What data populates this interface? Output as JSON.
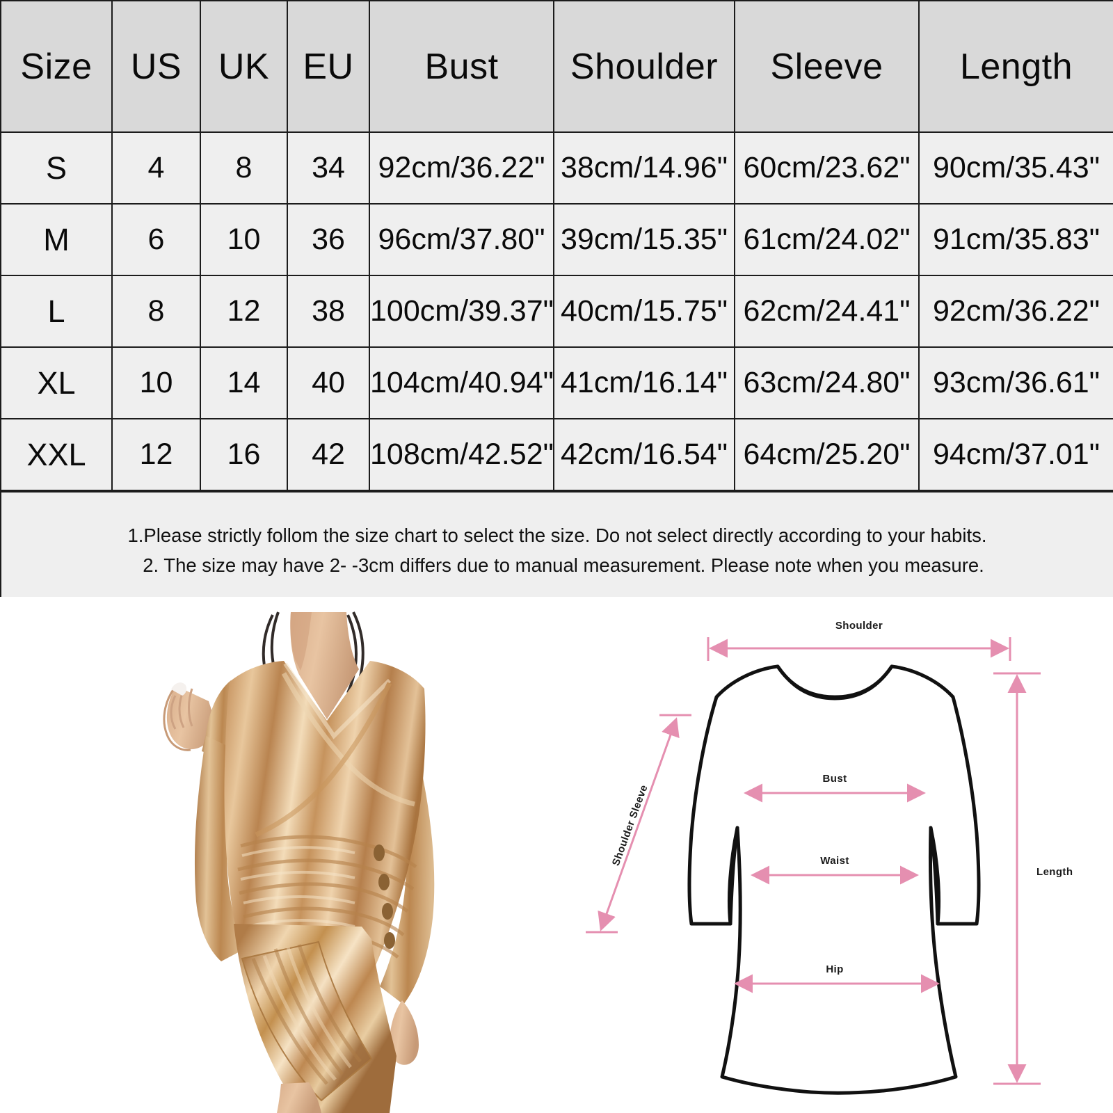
{
  "table": {
    "headers": [
      "Size",
      "US",
      "UK",
      "EU",
      "Bust",
      "Shoulder",
      "Sleeve",
      "Length"
    ],
    "rows": [
      {
        "size": "S",
        "us": "4",
        "uk": "8",
        "eu": "34",
        "bust": "92cm/36.22\"",
        "shoulder": "38cm/14.96\"",
        "sleeve": "60cm/23.62\"",
        "length": "90cm/35.43\""
      },
      {
        "size": "M",
        "us": "6",
        "uk": "10",
        "eu": "36",
        "bust": "96cm/37.80\"",
        "shoulder": "39cm/15.35\"",
        "sleeve": "61cm/24.02\"",
        "length": "91cm/35.83\""
      },
      {
        "size": "L",
        "us": "8",
        "uk": "12",
        "eu": "38",
        "bust": "100cm/39.37\"",
        "shoulder": "40cm/15.75\"",
        "sleeve": "62cm/24.41\"",
        "length": "92cm/36.22\""
      },
      {
        "size": "XL",
        "us": "10",
        "uk": "14",
        "eu": "40",
        "bust": "104cm/40.94\"",
        "shoulder": "41cm/16.14\"",
        "sleeve": "63cm/24.80\"",
        "length": "93cm/36.61\""
      },
      {
        "size": "XXL",
        "us": "12",
        "uk": "16",
        "eu": "42",
        "bust": "108cm/42.52\"",
        "shoulder": "42cm/16.54\"",
        "sleeve": "64cm/25.20\"",
        "length": "94cm/37.01\""
      }
    ],
    "notes": [
      "1.Please strictly follom the size chart to select the size. Do not select directly according to your habits.",
      "2. The size may have 2- -3cm differs due to manual measurement. Please note when you measure."
    ]
  },
  "diagram": {
    "labels": {
      "shoulder": "Shoulder",
      "shoulder_sleeve": "Shoulder Sleeve",
      "bust": "Bust",
      "waist": "Waist",
      "hip": "Hip",
      "length": "Length"
    },
    "colors": {
      "arrow": "#e58fb0",
      "outline": "#111111",
      "label": "#1a1a1a"
    }
  },
  "photo": {
    "alt": "woman-wearing-gold-metallic-ruched-bodycon-mini-dress",
    "colors": {
      "background": "#ffffff",
      "fabric_light": "#f0d3ae",
      "fabric_mid": "#d4a673",
      "fabric_dark": "#a8774a",
      "skin": "#e2bb99",
      "skin_shadow": "#c79a77",
      "hair": "#2b2320"
    }
  },
  "palette": {
    "header_bg": "#d9d9d9",
    "row_bg": "#efefef",
    "border": "#1c1c1c",
    "text": "#0a0a0a"
  }
}
